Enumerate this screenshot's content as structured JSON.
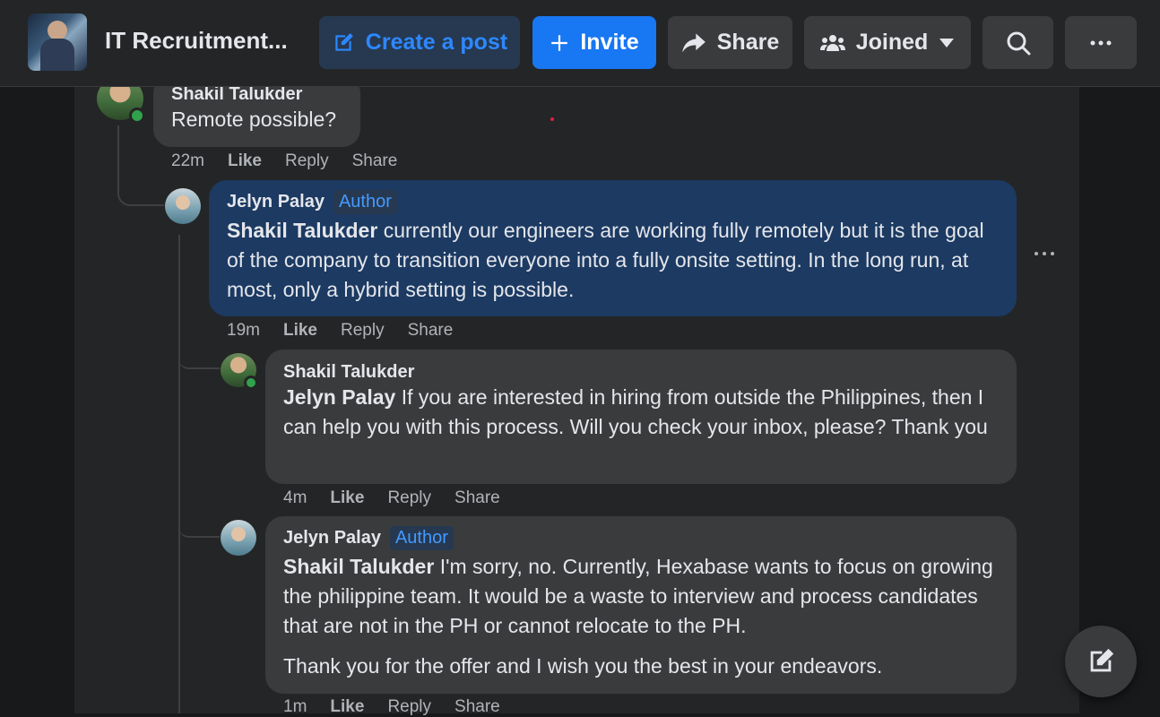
{
  "header": {
    "group_title": "IT Recruitment...",
    "create_post_label": "Create a post",
    "invite_label": "Invite",
    "share_label": "Share",
    "joined_label": "Joined"
  },
  "comments": [
    {
      "author": "Shakil Talukder",
      "text": "Remote possible?",
      "time": "22m",
      "online": true
    },
    {
      "author": "Jelyn Palay",
      "badge": "Author",
      "mention": "Shakil Talukder",
      "text": " currently our engineers are working fully remotely but it is the goal of the company to transition everyone into a fully onsite setting. In the long run, at most, only a hybrid setting is possible.",
      "time": "19m"
    },
    {
      "author": "Shakil Talukder",
      "mention": "Jelyn Palay",
      "text": " If you are interested in hiring from outside the Philippines, then I can help you with this process. Will you check your inbox, please? Thank you",
      "time": "4m",
      "online": true
    },
    {
      "author": "Jelyn Palay",
      "badge": "Author",
      "mention": "Shakil Talukder",
      "text": " I'm sorry, no. Currently, Hexabase wants to focus on growing the philippine team. It would be a waste to interview and process candidates that are not in the PH or cannot relocate to the PH.",
      "text2": "Thank you for the offer and I wish you the best in your endeavors.",
      "time": "1m"
    }
  ],
  "actions": {
    "like": "Like",
    "reply": "Reply",
    "share": "Share"
  },
  "colors": {
    "background": "#18191a",
    "surface": "#242526",
    "bubble": "#3a3b3c",
    "highlight_bubble": "#1c3a62",
    "accent": "#1877f2",
    "online": "#31a24c"
  }
}
